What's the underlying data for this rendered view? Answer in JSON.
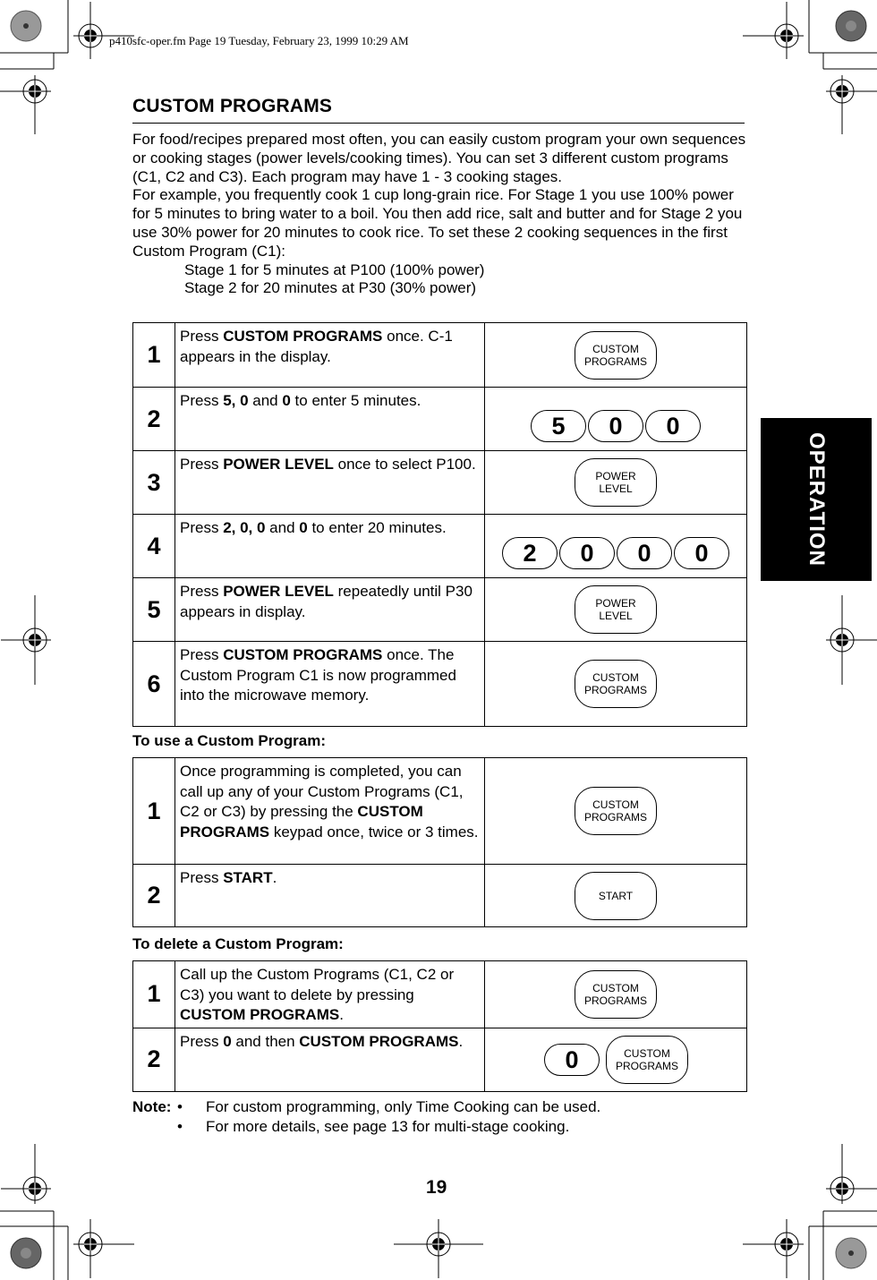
{
  "header": {
    "print_slug": "p410sfc-oper.fm  Page 19  Tuesday, February 23, 1999  10:29 AM"
  },
  "section_tab": "OPERATION",
  "title": "CUSTOM PROGRAMS",
  "intro": {
    "p1": "For food/recipes prepared most often, you can easily custom program your own sequences or cooking stages (power levels/cooking times). You can set 3 different custom programs (C1, C2 and C3). Each program may have 1 - 3 cooking stages.",
    "p2": "For example, you frequently cook 1 cup long-grain rice. For Stage 1 you use 100% power for 5 minutes to bring water to a boil. You then add rice, salt and butter and for Stage 2 you use 30% power for 20 minutes to cook rice. To set these 2 cooking sequences in the first Custom Program (C1):",
    "stage1": "Stage 1 for 5 minutes at P100 (100% power)",
    "stage2": "Stage 2 for 20 minutes at P30 (30% power)"
  },
  "program_steps": [
    {
      "num": "1",
      "pre": "Press ",
      "bold": "CUSTOM PROGRAMS",
      "post": " once. C-1 appears in the display.",
      "keys": [
        "CUSTOM",
        "PROGRAMS"
      ]
    },
    {
      "num": "2",
      "pre": "Press ",
      "bold": "5, 0",
      "mid": " and ",
      "bold2": "0",
      "post": " to enter 5 minutes.",
      "digits": [
        "5",
        "0",
        "0"
      ]
    },
    {
      "num": "3",
      "pre": "Press ",
      "bold": "POWER LEVEL",
      "post": " once to select P100.",
      "keys": [
        "POWER",
        "LEVEL"
      ]
    },
    {
      "num": "4",
      "pre": "Press ",
      "bold": "2, 0, 0",
      "mid": " and ",
      "bold2": "0",
      "post": " to enter 20 minutes.",
      "digits": [
        "2",
        "0",
        "0",
        "0"
      ]
    },
    {
      "num": "5",
      "pre": "Press ",
      "bold": "POWER LEVEL",
      "post": " repeatedly until P30 appears in display.",
      "keys": [
        "POWER",
        "LEVEL"
      ]
    },
    {
      "num": "6",
      "pre": "Press ",
      "bold": "CUSTOM PROGRAMS",
      "post": " once. The Custom Program C1 is now programmed into the microwave memory.",
      "keys": [
        "CUSTOM",
        "PROGRAMS"
      ]
    }
  ],
  "use_heading": "To use a Custom Program:",
  "use_steps": [
    {
      "num": "1",
      "pre": "Once programming is completed, you can call up any of your Custom Programs (C1, C2 or C3) by pressing the ",
      "bold": "CUSTOM PROGRAMS",
      "post": " keypad once, twice or 3 times.",
      "keys": [
        "CUSTOM",
        "PROGRAMS"
      ]
    },
    {
      "num": "2",
      "pre": "Press ",
      "bold": "START",
      "post": ".",
      "keys": [
        "START"
      ]
    }
  ],
  "delete_heading": "To delete a Custom Program:",
  "delete_steps": [
    {
      "num": "1",
      "pre": "Call up the Custom Programs (C1, C2 or C3) you want to delete by pressing ",
      "bold": "CUSTOM PROGRAMS",
      "post": ".",
      "keys": [
        "CUSTOM",
        "PROGRAMS"
      ]
    },
    {
      "num": "2",
      "pre": "Press ",
      "bold": "0",
      "mid": " and then ",
      "bold2": "CUSTOM PROGRAMS",
      "post": ".",
      "digit": "0",
      "keys": [
        "CUSTOM",
        "PROGRAMS"
      ]
    }
  ],
  "note": {
    "label": "Note:",
    "bullet": "•",
    "items": [
      "For custom programming, only Time Cooking can be used.",
      "For more details, see page 13 for multi-stage cooking."
    ]
  },
  "page_number": "19"
}
